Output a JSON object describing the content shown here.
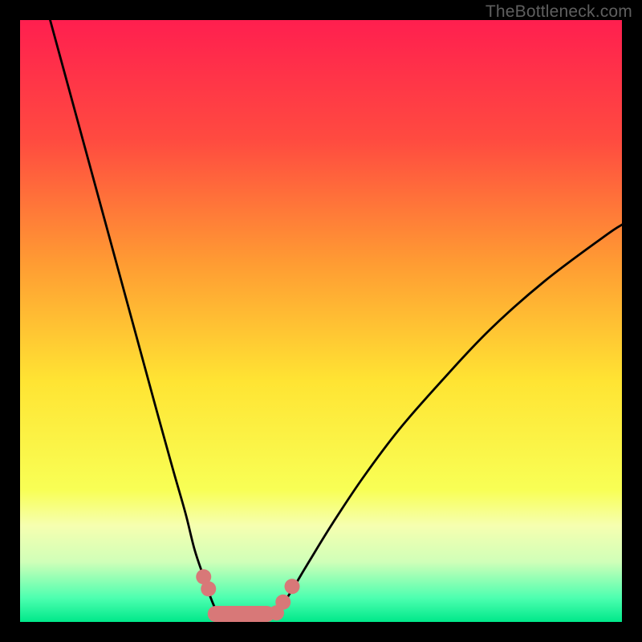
{
  "watermark": "TheBottleneck.com",
  "chart_data": {
    "type": "line",
    "title": "",
    "xlabel": "",
    "ylabel": "",
    "xlim": [
      0,
      100
    ],
    "ylim": [
      0,
      100
    ],
    "background_gradient": {
      "stops": [
        {
          "pos": 0.0,
          "color": "#ff1f4f"
        },
        {
          "pos": 0.2,
          "color": "#ff4b40"
        },
        {
          "pos": 0.4,
          "color": "#ff9a33"
        },
        {
          "pos": 0.6,
          "color": "#ffe433"
        },
        {
          "pos": 0.78,
          "color": "#f8ff55"
        },
        {
          "pos": 0.84,
          "color": "#f6ffb0"
        },
        {
          "pos": 0.9,
          "color": "#d0ffb8"
        },
        {
          "pos": 0.96,
          "color": "#4dffb0"
        },
        {
          "pos": 1.0,
          "color": "#00e88a"
        }
      ]
    },
    "series": [
      {
        "name": "left-branch",
        "x": [
          5,
          8,
          11,
          14,
          17,
          20,
          23,
          25.5,
          27.5,
          29,
          30.5,
          31.5,
          32.3,
          33,
          33.5
        ],
        "y": [
          100,
          89,
          78,
          67,
          56,
          45,
          34,
          25,
          18,
          12,
          7.5,
          4.5,
          2.5,
          1.2,
          0.5
        ]
      },
      {
        "name": "right-branch",
        "x": [
          41.5,
          43,
          45,
          48,
          52,
          57,
          63,
          70,
          78,
          87,
          97,
          100
        ],
        "y": [
          0.5,
          2,
          5,
          10,
          16.5,
          24,
          32,
          40,
          48.5,
          56.5,
          64,
          66
        ]
      }
    ],
    "markers": {
      "left": [
        {
          "x": 30.5,
          "y": 7.5
        },
        {
          "x": 31.3,
          "y": 5.5
        }
      ],
      "right": [
        {
          "x": 42.6,
          "y": 1.5
        },
        {
          "x": 43.7,
          "y": 3.3
        },
        {
          "x": 45.2,
          "y": 5.9
        }
      ],
      "bottom_bar": {
        "x0": 32.5,
        "y": 0.0,
        "x1": 41.0
      }
    }
  }
}
